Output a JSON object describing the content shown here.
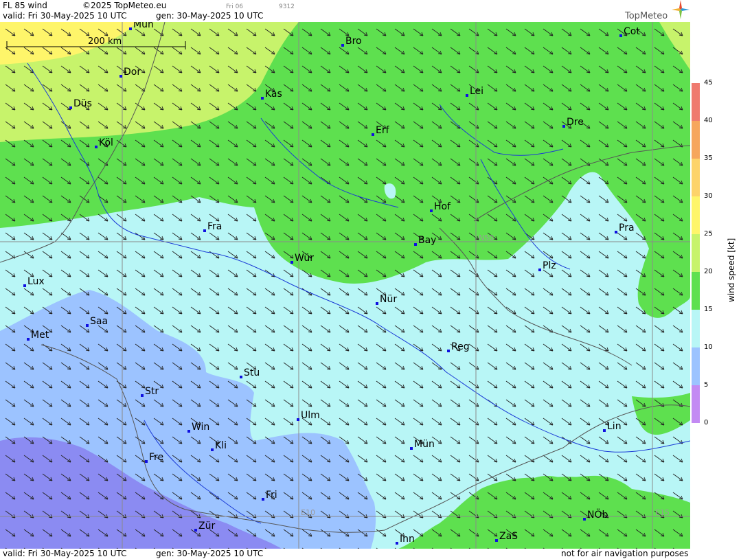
{
  "header": {
    "product": "FL 85 wind",
    "copyright": "©2025 TopMeteo.eu",
    "day_small": "Fri 06",
    "code_small": "9312",
    "valid": "valid:  Fri  30-May-2025  10 UTC",
    "gen": "gen:  30-May-2025 10 UTC",
    "logo": "TopMeteo"
  },
  "footer": {
    "valid": "valid:  Fri  30-May-2025  10 UTC",
    "gen": "gen:  30-May-2025 10 UTC",
    "disclaimer": "not for air navigation purposes"
  },
  "scale_bar": {
    "label": "200 km"
  },
  "grid_labels": {
    "n50": "N50",
    "e10": "E10",
    "e15": "E15"
  },
  "cities": [
    {
      "name": "Mün_top",
      "label": "Mün"
    },
    {
      "name": "Bro",
      "label": "Bro"
    },
    {
      "name": "Cot",
      "label": "Cot"
    },
    {
      "name": "Dor",
      "label": "Dor"
    },
    {
      "name": "Kas",
      "label": "Kas"
    },
    {
      "name": "Lei",
      "label": "Lei"
    },
    {
      "name": "Düs",
      "label": "Düs"
    },
    {
      "name": "Erf",
      "label": "Erf"
    },
    {
      "name": "Dre",
      "label": "Dre"
    },
    {
      "name": "Köl",
      "label": "Köl"
    },
    {
      "name": "Hof",
      "label": "Hof"
    },
    {
      "name": "Fra",
      "label": "Fra"
    },
    {
      "name": "Pra",
      "label": "Pra"
    },
    {
      "name": "Bay",
      "label": "Bay"
    },
    {
      "name": "Wür",
      "label": "Wür"
    },
    {
      "name": "Plz",
      "label": "Plz"
    },
    {
      "name": "Lux",
      "label": "Lux"
    },
    {
      "name": "Nür",
      "label": "Nür"
    },
    {
      "name": "Saa",
      "label": "Saa"
    },
    {
      "name": "Met",
      "label": "Met"
    },
    {
      "name": "Reg",
      "label": "Reg"
    },
    {
      "name": "Stu",
      "label": "Stu"
    },
    {
      "name": "Str",
      "label": "Str"
    },
    {
      "name": "Ulm",
      "label": "Ulm"
    },
    {
      "name": "Win",
      "label": "Win"
    },
    {
      "name": "Lin",
      "label": "Lin"
    },
    {
      "name": "Kli",
      "label": "Kli"
    },
    {
      "name": "Mün",
      "label": "Mün"
    },
    {
      "name": "Fre",
      "label": "Fre"
    },
    {
      "name": "Fri",
      "label": "Fri"
    },
    {
      "name": "NÖb",
      "label": "NÖb"
    },
    {
      "name": "Zür",
      "label": "Zür"
    },
    {
      "name": "ZaS",
      "label": "ZaS"
    },
    {
      "name": "Inn",
      "label": "Inn"
    }
  ],
  "legend": {
    "title": "wind speed [kt]",
    "ticks": [
      "45",
      "40",
      "35",
      "30",
      "25",
      "20",
      "15",
      "10",
      "5",
      "0"
    ],
    "colors": [
      "#ef7a6e",
      "#f6a65d",
      "#fdd36a",
      "#fef56a",
      "#c7f36b",
      "#5ee04f",
      "#b8f6f6",
      "#9cc3ff",
      "#8b8bf2",
      "#c38af3"
    ]
  },
  "colors": {
    "green": "#5ee04f",
    "yellowgreen": "#c7f36b",
    "yellow": "#fef56a",
    "cyan": "#b8f6f6",
    "blue": "#9cc3ff",
    "violet": "#8b8bf2"
  }
}
